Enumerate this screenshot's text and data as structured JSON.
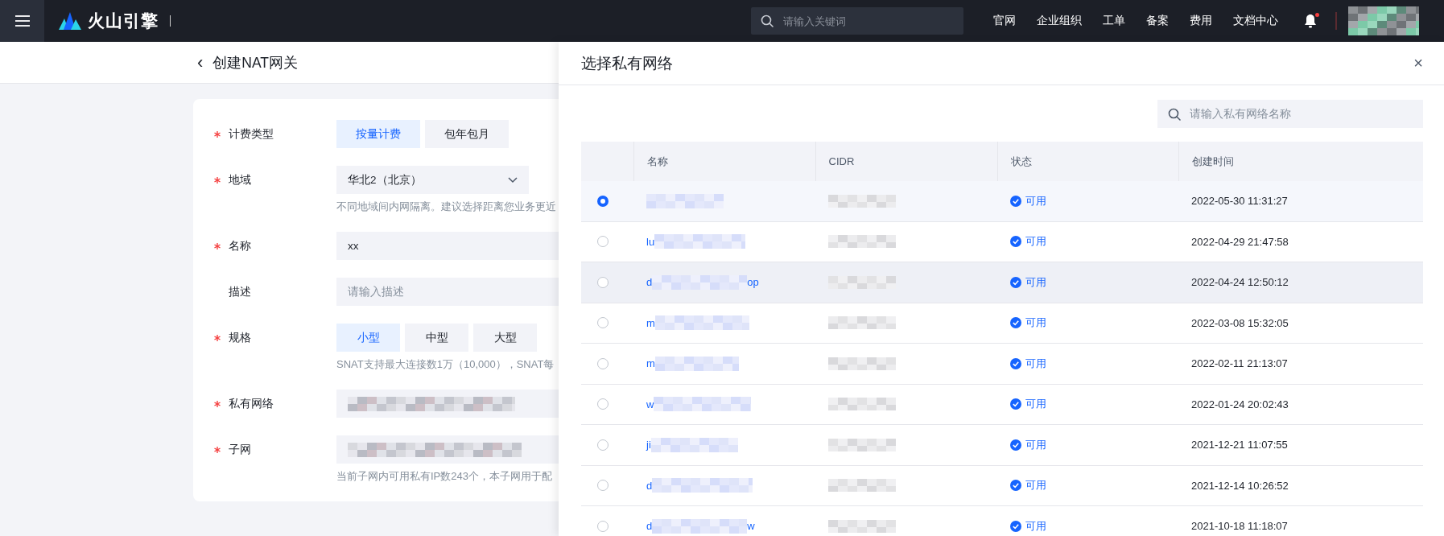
{
  "top_bar": {
    "logo": "火山引擎",
    "search": {
      "placeholder": "请输入关键词"
    },
    "nav": [
      "官网",
      "企业组织",
      "工单",
      "备案",
      "费用",
      "文档中心"
    ],
    "notification_dot": true
  },
  "page": {
    "back": "‹",
    "title": "创建NAT网关",
    "form": [
      {
        "label": "计费类型",
        "required": true,
        "kind": "segmented",
        "options": [
          {
            "label": "按量计费",
            "selected": true
          },
          {
            "label": "包年包月",
            "selected": false
          }
        ]
      },
      {
        "label": "地域",
        "required": true,
        "kind": "select",
        "value": "华北2（北京）",
        "hint": "不同地域间内网隔离。建议选择距离您业务更近"
      },
      {
        "label": "名称",
        "required": true,
        "kind": "input",
        "value": "xx"
      },
      {
        "label": "描述",
        "required": false,
        "kind": "input",
        "placeholder": "请输入描述"
      },
      {
        "label": "规格",
        "required": true,
        "kind": "segmented",
        "options": [
          {
            "label": "小型",
            "selected": true
          },
          {
            "label": "中型",
            "selected": false
          },
          {
            "label": "大型",
            "selected": false
          }
        ],
        "hint": "SNAT支持最大连接数1万（10,000），SNAT每"
      },
      {
        "label": "私有网络",
        "required": true,
        "kind": "redacted"
      },
      {
        "label": "子网",
        "required": true,
        "kind": "redacted",
        "hint": "当前子网内可用私有IP数243个，本子网用于配"
      }
    ]
  },
  "drawer": {
    "title": "选择私有网络",
    "close": "×",
    "search": {
      "placeholder": "请输入私有网络名称"
    },
    "columns": [
      "名称",
      "CIDR",
      "状态",
      "创建时间"
    ],
    "rows": [
      {
        "selected": true,
        "hovered": false,
        "status": "可用",
        "created": "2022-05-30 11:31:27"
      },
      {
        "selected": false,
        "hovered": false,
        "name_start": "lu",
        "status": "可用",
        "created": "2022-04-29 21:47:58"
      },
      {
        "selected": false,
        "hovered": true,
        "name_start": "d",
        "name_end": "op",
        "status": "可用",
        "created": "2022-04-24 12:50:12"
      },
      {
        "selected": false,
        "hovered": false,
        "name_start": "m",
        "status": "可用",
        "created": "2022-03-08 15:32:05"
      },
      {
        "selected": false,
        "hovered": false,
        "name_start": "m",
        "status": "可用",
        "created": "2022-02-11 21:13:07"
      },
      {
        "selected": false,
        "hovered": false,
        "name_start": "w",
        "status": "可用",
        "created": "2022-01-24 20:02:43"
      },
      {
        "selected": false,
        "hovered": false,
        "name_start": "ji",
        "status": "可用",
        "created": "2021-12-21 11:07:55"
      },
      {
        "selected": false,
        "hovered": false,
        "name_start": "d",
        "status": "可用",
        "created": "2021-12-14 10:26:52"
      },
      {
        "selected": false,
        "hovered": false,
        "name_start": "d",
        "name_end": "w",
        "status": "可用",
        "created": "2021-10-18 11:18:07"
      }
    ]
  }
}
